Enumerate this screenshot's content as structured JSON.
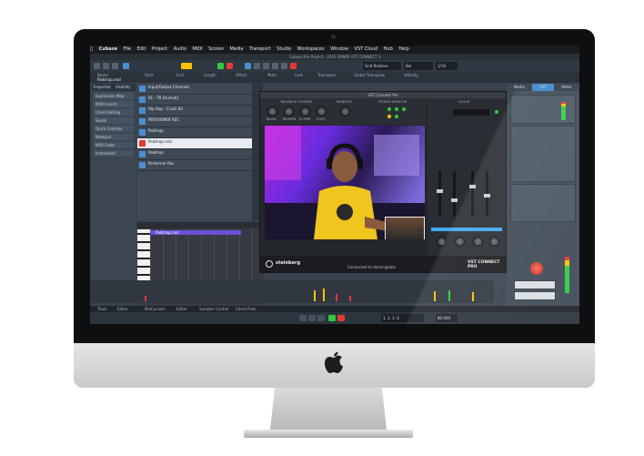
{
  "menubar": {
    "items": [
      "Cubase",
      "File",
      "Edit",
      "Project",
      "Audio",
      "MIDI",
      "Scores",
      "Media",
      "Transport",
      "Studio",
      "Workspaces",
      "Window",
      "VST Cloud",
      "Hub",
      "Help"
    ]
  },
  "window": {
    "title": "Cubase Pro Project - 2019 DANPE VST CONNECT 3"
  },
  "toolbar": {
    "grid_type": "Grid Relative",
    "quantize": "1/16",
    "bar": "Bar"
  },
  "track_info": {
    "name": "Padshop.mid",
    "columns": [
      "Name",
      "Start",
      "End",
      "Length",
      "Offset",
      "Mute",
      "Lock",
      "Transpose",
      "Global Transpose",
      "Velocity"
    ]
  },
  "inspector": {
    "tab": "Inspector",
    "tab2": "Visibility",
    "rows": [
      "Expression Map",
      "MIDI Inserts",
      "Chord Editing",
      "Sends",
      "Quick Controls",
      "Notepad",
      "MIDI Fader",
      "Instrument"
    ]
  },
  "tracks": [
    {
      "name": "Input/Output Channels"
    },
    {
      "name": "01 - TR Drums01"
    },
    {
      "name": "Hip Hop - Crush Kit"
    },
    {
      "name": "PERFORMER REC"
    },
    {
      "name": "Padshop"
    },
    {
      "name": "Padshop.mid"
    },
    {
      "name": "Padshop"
    },
    {
      "name": "Performer Rec"
    }
  ],
  "editor": {
    "clip_name": "Padshop.mid"
  },
  "vst_connect": {
    "title": "VST Connect Pro",
    "section_talkback": "TALKBACK CONTROL",
    "section_monitor": "MONITOR",
    "section_studio": "STUDIO MONITOR",
    "section_cloud": "CLOUD",
    "knob_labels": [
      "TALKB.",
      "REVERB",
      "TC PERF",
      "FOOT"
    ],
    "brand": "steinberg",
    "product": "VST CONNECT PRO",
    "status": "Connected to dominigates"
  },
  "rightzone": {
    "tabs": [
      "Media",
      "VST",
      "Meter"
    ]
  },
  "bottom_tabs": [
    "Track",
    "Editor",
    "MixConsole",
    "Editor",
    "Sampler Control",
    "Chord Pads"
  ],
  "transport": {
    "time": "1. 1. 1. 0",
    "tempo": "80.000"
  },
  "colors": {
    "accent": "#4a8fd0",
    "record": "#e53935",
    "play": "#2ecc40",
    "clip": "#6a4fd8"
  }
}
